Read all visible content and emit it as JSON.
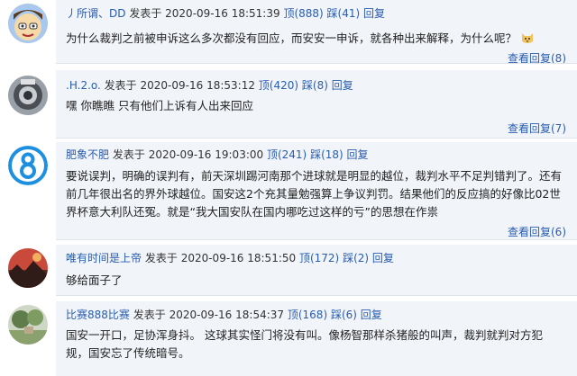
{
  "comments": [
    {
      "user": "丿所谓、DD",
      "posted_label": "发表于",
      "timestamp": "2020-09-16 18:51:39",
      "up": "顶(888)",
      "down": "踩(41)",
      "reply": "回复",
      "text": "为什么裁判之前被申诉这么多次都没有回应，而安安一申诉，就各种出来解释，为什么呢？",
      "view_replies": "查看回复(8)",
      "avatar_icon": "cartoon-face-avatar"
    },
    {
      "user": ".H.2.o.",
      "posted_label": "发表于",
      "timestamp": "2020-09-16 18:53:12",
      "up": "顶(420)",
      "down": "踩(8)",
      "reply": "回复",
      "text": "嘿 你瞧瞧 只有他们上诉有人出来回应",
      "view_replies": "查看回复(7)",
      "avatar_icon": "photo-avatar"
    },
    {
      "user": "肥象不肥",
      "posted_label": "发表于",
      "timestamp": "2020-09-16 19:03:00",
      "up": "顶(241)",
      "down": "踩(18)",
      "reply": "回复",
      "text": "要说误判，明确的误判有，前天深圳踢河南那个进球就是明显的越位，裁判水平不足判错判了。还有前几年很出名的界外球越位。国安这2个充其量勉强算上争议判罚。结果他们的反应搞的好像比02世界杯意大利队还冤。就是“我大国安队在国内哪吃过这样的亏”的思想在作祟",
      "view_replies": "查看回复(6)",
      "avatar_icon": "number-8-avatar"
    },
    {
      "user": "唯有时间是上帝",
      "posted_label": "发表于",
      "timestamp": "2020-09-16 18:51:50",
      "up": "顶(172)",
      "down": "踩(2)",
      "reply": "回复",
      "text": "够给面子了",
      "view_replies": "",
      "avatar_icon": "landscape-avatar"
    },
    {
      "user": "比赛888比赛",
      "posted_label": "发表于",
      "timestamp": "2020-09-16 18:54:37",
      "up": "顶(168)",
      "down": "踩(6)",
      "reply": "回复",
      "text": "国安一开口，足协浑身抖。 这球其实怪门将没有叫。像杨智那样杀猪般的叫声，裁判就判对方犯规，国安忘了传统暗号。",
      "view_replies": "",
      "avatar_icon": "garden-avatar"
    }
  ],
  "colors": {
    "link": "#2a5db0",
    "panel_bg": "#f1f4f9",
    "text": "#222222"
  }
}
